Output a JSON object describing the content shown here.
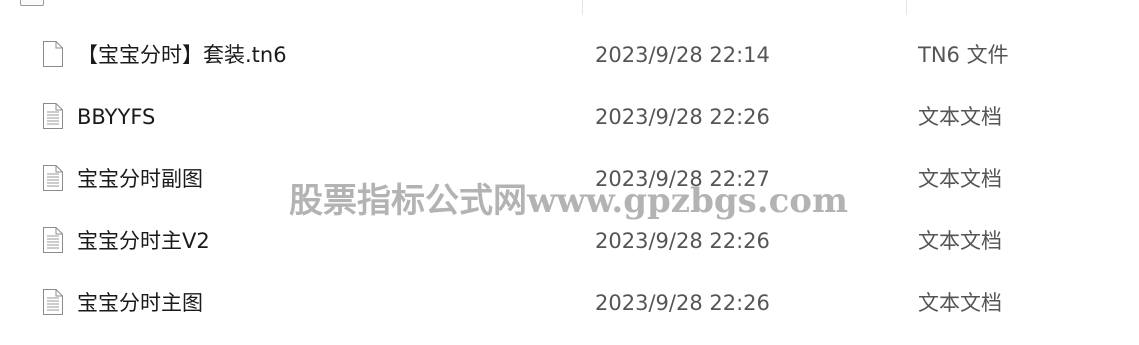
{
  "files": [
    {
      "name": "【宝宝分时】套装.tn6",
      "date": "2023/9/28 22:14",
      "type": "TN6 文件",
      "icon": "blank-file-icon"
    },
    {
      "name": "BBYYFS",
      "date": "2023/9/28 22:26",
      "type": "文本文档",
      "icon": "text-file-icon"
    },
    {
      "name": "宝宝分时副图",
      "date": "2023/9/28 22:27",
      "type": "文本文档",
      "icon": "text-file-icon"
    },
    {
      "name": "宝宝分时主V2",
      "date": "2023/9/28 22:26",
      "type": "文本文档",
      "icon": "text-file-icon"
    },
    {
      "name": "宝宝分时主图",
      "date": "2023/9/28 22:26",
      "type": "文本文档",
      "icon": "text-file-icon"
    }
  ],
  "watermark": "股票指标公式网www.gpzbgs.com"
}
